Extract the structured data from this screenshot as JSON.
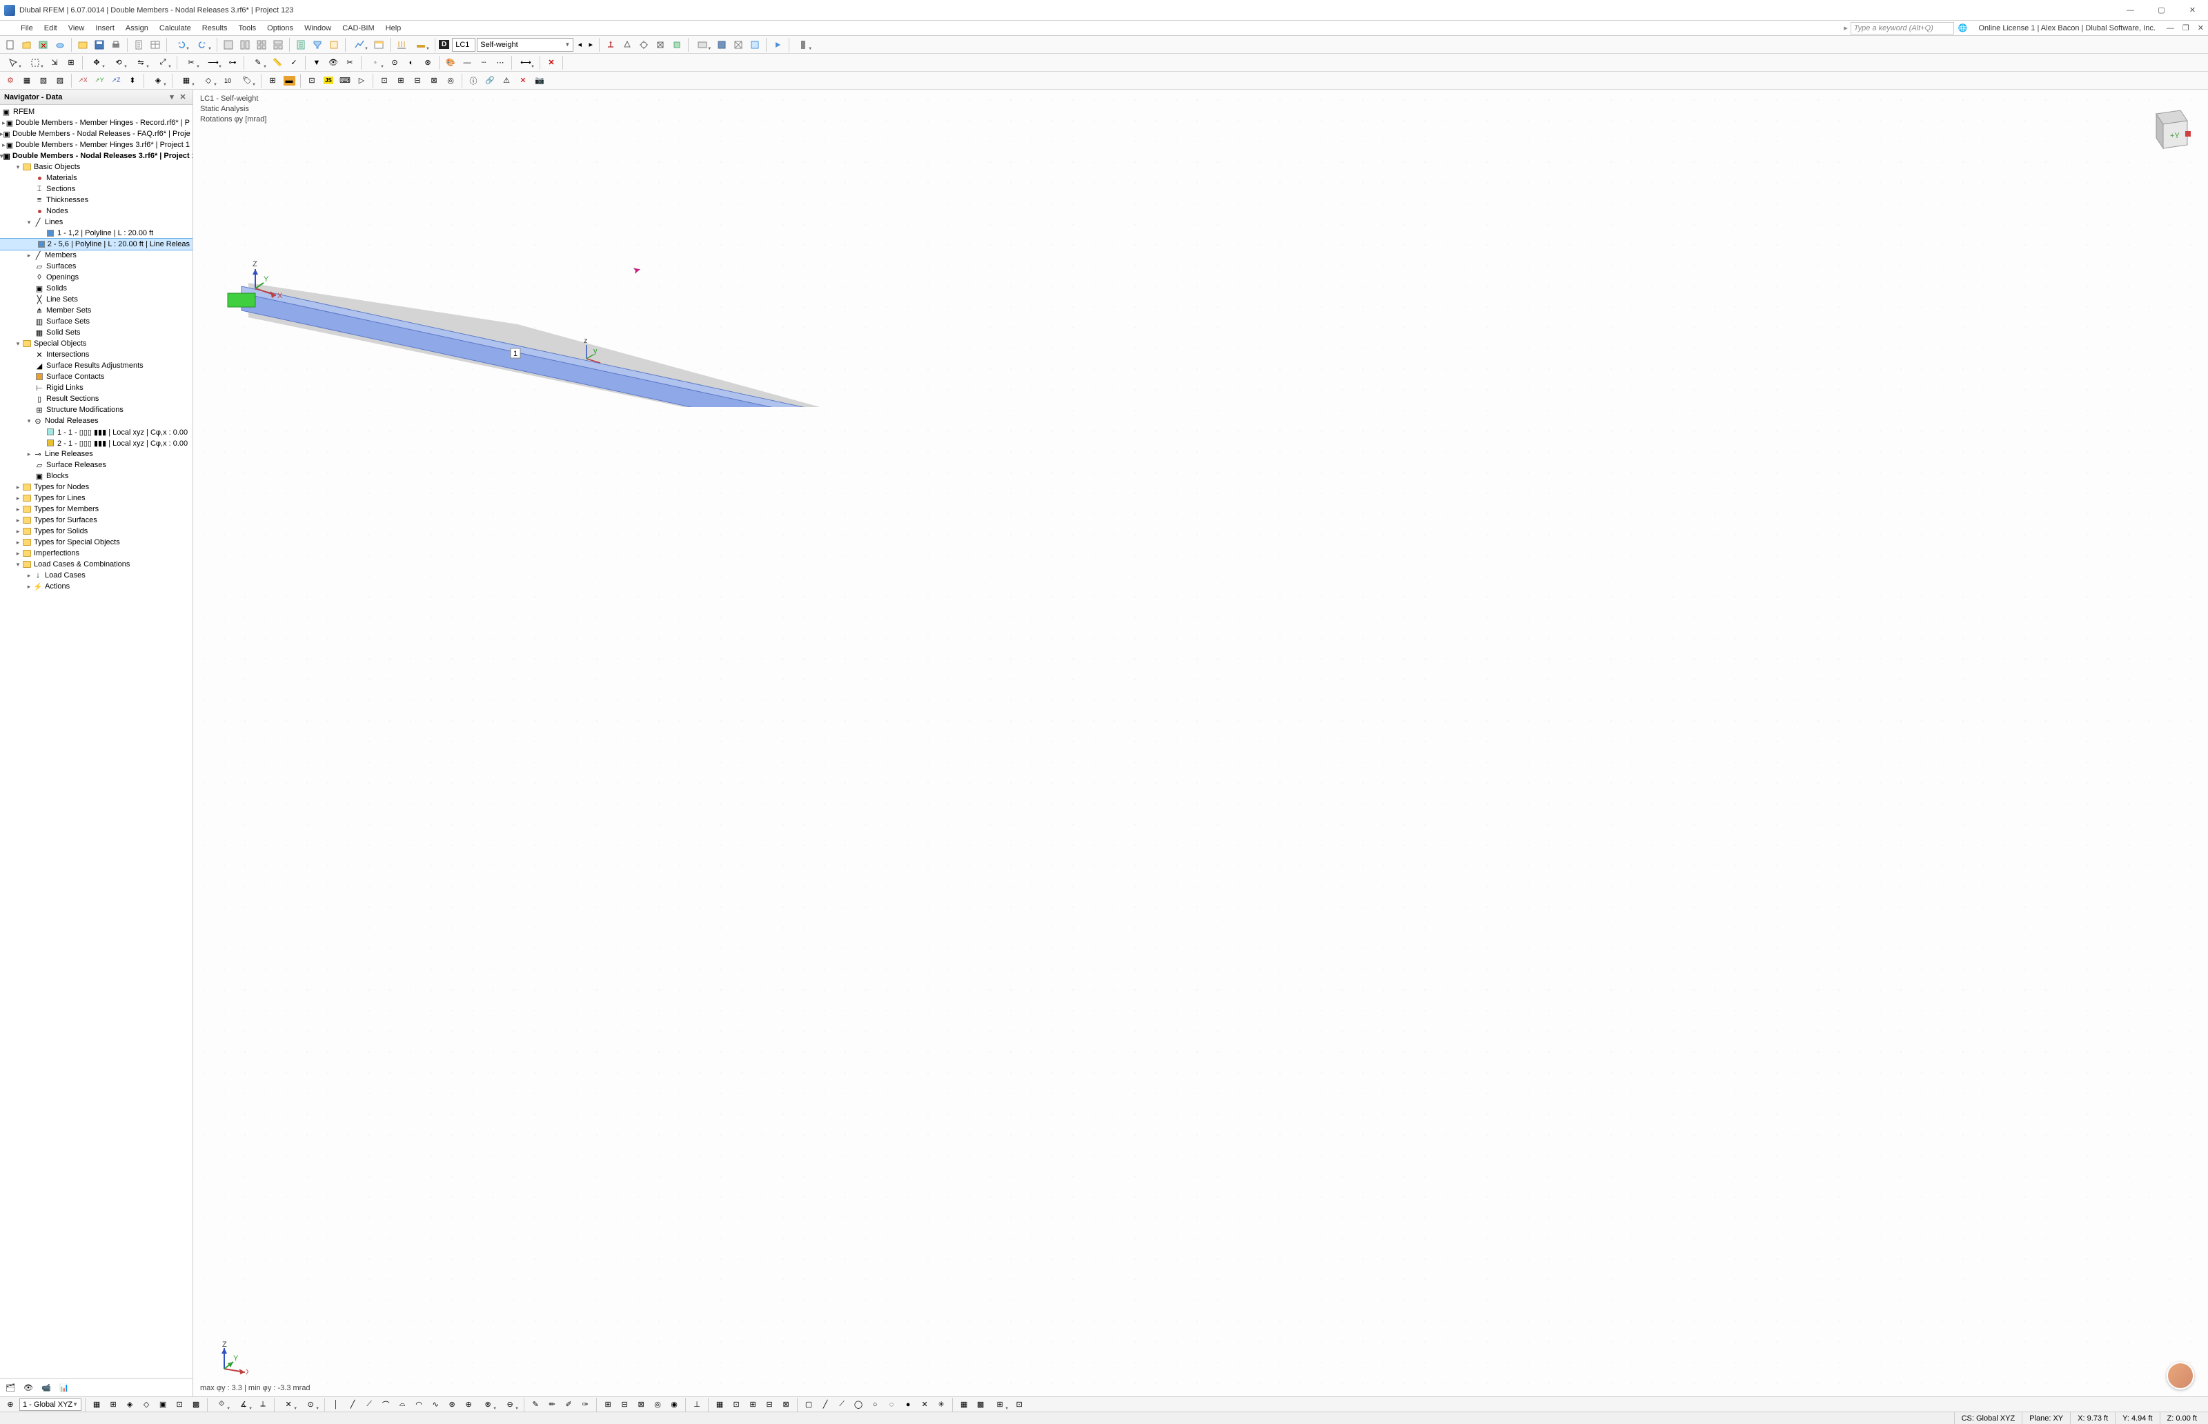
{
  "title": "Dlubal RFEM | 6.07.0014 | Double Members - Nodal Releases 3.rf6* | Project 123",
  "menu": [
    "File",
    "Edit",
    "View",
    "Insert",
    "Assign",
    "Calculate",
    "Results",
    "Tools",
    "Options",
    "Window",
    "CAD-BIM",
    "Help"
  ],
  "keyword_placeholder": "Type a keyword (Alt+Q)",
  "license": "Online License 1 | Alex Bacon | Dlubal Software, Inc.",
  "lc_badge": "D",
  "lc_code": "LC1",
  "lc_name": "Self-weight",
  "nav_title": "Navigator - Data",
  "tree_root": "RFEM",
  "tree_files": [
    "Double Members - Member Hinges - Record.rf6* | P",
    "Double Members - Nodal Releases - FAQ.rf6* | Proje",
    "Double Members - Member Hinges 3.rf6* | Project 1",
    "Double Members - Nodal Releases 3.rf6* | Project 1"
  ],
  "basic_objects": "Basic Objects",
  "bo_children": {
    "materials": "Materials",
    "sections": "Sections",
    "thicknesses": "Thicknesses",
    "nodes": "Nodes",
    "lines": "Lines",
    "line1": "1 - 1,2 | Polyline | L : 20.00 ft",
    "line2": "2 - 5,6 | Polyline | L : 20.00 ft | Line Releas",
    "members": "Members",
    "surfaces": "Surfaces",
    "openings": "Openings",
    "solids": "Solids",
    "linesets": "Line Sets",
    "membersets": "Member Sets",
    "surfacesets": "Surface Sets",
    "solidsets": "Solid Sets"
  },
  "special_objects": "Special Objects",
  "so_children": {
    "intersections": "Intersections",
    "sra": "Surface Results Adjustments",
    "surfcontacts": "Surface Contacts",
    "rigidlinks": "Rigid Links",
    "resultsections": "Result Sections",
    "structmods": "Structure Modifications",
    "nodalreleases": "Nodal Releases",
    "nr1": "1 - 1 - ▯▯▯ ▮▮▮ | Local xyz | Cφ,x : 0.00",
    "nr2": "2 - 1 - ▯▯▯ ▮▮▮ | Local xyz | Cφ,x : 0.00",
    "linereleases": "Line Releases",
    "surfreleases": "Surface Releases",
    "blocks": "Blocks"
  },
  "other_folders": [
    "Types for Nodes",
    "Types for Lines",
    "Types for Members",
    "Types for Surfaces",
    "Types for Solids",
    "Types for Special Objects",
    "Imperfections",
    "Load Cases & Combinations"
  ],
  "lcc_children": {
    "loadcases": "Load Cases",
    "actions": "Actions"
  },
  "viewport": {
    "lc_line": "LC1 - Self-weight",
    "analysis": "Static Analysis",
    "rotations": "Rotations φy [mrad]",
    "footer": "max φy : 3.3 | min φy : -3.3 mrad",
    "beam_label": "1"
  },
  "status": {
    "cs_option": "1 - Global XYZ",
    "cs": "CS: Global XYZ",
    "plane": "Plane: XY",
    "x": "X: 9.73 ft",
    "y": "Y: 4.94 ft",
    "z": "Z: 0.00 ft"
  }
}
